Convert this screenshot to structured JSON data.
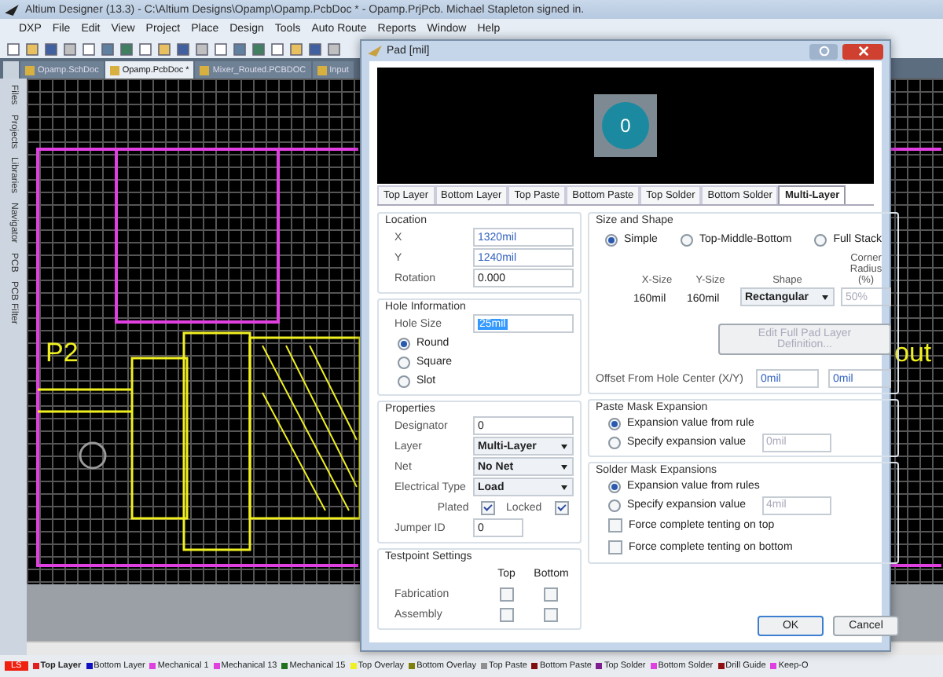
{
  "window": {
    "title": "Altium Designer (13.3) - C:\\Altium Designs\\Opamp\\Opamp.PcbDoc * - Opamp.PrjPcb. Michael Stapleton signed in."
  },
  "menu": [
    "DXP",
    "File",
    "Edit",
    "View",
    "Project",
    "Place",
    "Design",
    "Tools",
    "Auto Route",
    "Reports",
    "Window",
    "Help"
  ],
  "doc_tabs": [
    {
      "label": "Opamp.SchDoc",
      "selected": false
    },
    {
      "label": "Opamp.PcbDoc *",
      "selected": true
    },
    {
      "label": "Mixer_Routed.PCBDOC",
      "selected": false
    },
    {
      "label": "Input",
      "selected": false
    }
  ],
  "side_panels": [
    "Files",
    "Projects",
    "Libraries",
    "Navigator",
    "PCB",
    "PCB Filter"
  ],
  "canvas": {
    "left_label": "P2",
    "right_label": "out"
  },
  "dialog": {
    "title": "Pad [mil]",
    "pad_preview": {
      "designator": "0"
    },
    "tabs": [
      {
        "label": "Top Layer",
        "selected": false
      },
      {
        "label": "Bottom Layer",
        "selected": false
      },
      {
        "label": "Top Paste",
        "selected": false
      },
      {
        "label": "Bottom Paste",
        "selected": false
      },
      {
        "label": "Top Solder",
        "selected": false
      },
      {
        "label": "Bottom Solder",
        "selected": false
      },
      {
        "label": "Multi-Layer",
        "selected": true
      }
    ],
    "location": {
      "title": "Location",
      "fields": [
        {
          "label": "X",
          "value": "1320mil"
        },
        {
          "label": "Y",
          "value": "1240mil"
        },
        {
          "label": "Rotation",
          "value": "0.000"
        }
      ]
    },
    "hole": {
      "title": "Hole Information",
      "label": "Hole Size",
      "value": "25mil",
      "value_selected": true,
      "shapes": [
        {
          "label": "Round",
          "selected": true
        },
        {
          "label": "Square",
          "selected": false
        },
        {
          "label": "Slot",
          "selected": false
        }
      ]
    },
    "properties": {
      "title": "Properties",
      "rows": [
        {
          "kind": "text",
          "label": "Designator",
          "value": "0"
        },
        {
          "kind": "select",
          "label": "Layer",
          "value": "Multi-Layer"
        },
        {
          "kind": "select",
          "label": "Net",
          "value": "No Net"
        },
        {
          "kind": "select",
          "label": "Electrical Type",
          "value": "Load"
        }
      ],
      "checks": [
        {
          "label": "Plated",
          "checked": true
        },
        {
          "label": "Locked",
          "checked": true
        }
      ],
      "jumper": {
        "label": "Jumper ID",
        "value": "0"
      }
    },
    "testpoint": {
      "title": "Testpoint Settings",
      "columns": [
        "Top",
        "Bottom"
      ],
      "rows": [
        {
          "label": "Fabrication",
          "top": false,
          "bottom": false
        },
        {
          "label": "Assembly",
          "top": false,
          "bottom": false
        }
      ]
    },
    "size_shape": {
      "title": "Size and Shape",
      "modes": [
        {
          "label": "Simple",
          "selected": true
        },
        {
          "label": "Top-Middle-Bottom",
          "selected": false
        },
        {
          "label": "Full Stack",
          "selected": false
        }
      ],
      "columns": [
        "X-Size",
        "Y-Size",
        "Shape",
        "Corner Radius (%)"
      ],
      "x_size": "160mil",
      "y_size": "160mil",
      "shape": "Rectangular",
      "corner_radius": {
        "value": "50%",
        "disabled": true
      },
      "edit_button": {
        "label": "Edit Full Pad Layer Definition...",
        "disabled": true
      },
      "offset": {
        "label": "Offset From Hole Center (X/Y)",
        "x": "0mil",
        "y": "0mil"
      }
    },
    "paste_mask": {
      "title": "Paste Mask Expansion",
      "options": [
        {
          "label": "Expansion value from rule",
          "selected": true
        },
        {
          "label": "Specify expansion value",
          "selected": false,
          "value": "0mil"
        }
      ]
    },
    "solder_mask": {
      "title": "Solder Mask Expansions",
      "options": [
        {
          "label": "Expansion value from rules",
          "selected": true
        },
        {
          "label": "Specify expansion value",
          "selected": false,
          "value": "4mil"
        }
      ],
      "checks": [
        {
          "label": "Force complete tenting on top",
          "checked": false
        },
        {
          "label": "Force complete tenting on bottom",
          "checked": false
        }
      ]
    },
    "buttons": [
      {
        "label": "OK",
        "default": true
      },
      {
        "label": "Cancel",
        "default": false
      }
    ]
  },
  "layer_bar": {
    "ls": "LS",
    "layers": [
      {
        "label": "Top Layer",
        "color": "#e02020",
        "selected": true
      },
      {
        "label": "Bottom Layer",
        "color": "#1010c0",
        "selected": false
      },
      {
        "label": "Mechanical 1",
        "color": "#e040e0",
        "selected": false
      },
      {
        "label": "Mechanical 13",
        "color": "#e040e0",
        "selected": false
      },
      {
        "label": "Mechanical 15",
        "color": "#207020",
        "selected": false
      },
      {
        "label": "Top Overlay",
        "color": "#f0f020",
        "selected": false
      },
      {
        "label": "Bottom Overlay",
        "color": "#808010",
        "selected": false
      },
      {
        "label": "Top Paste",
        "color": "#909090",
        "selected": false
      },
      {
        "label": "Bottom Paste",
        "color": "#801010",
        "selected": false
      },
      {
        "label": "Top Solder",
        "color": "#802090",
        "selected": false
      },
      {
        "label": "Bottom Solder",
        "color": "#e040e0",
        "selected": false
      },
      {
        "label": "Drill Guide",
        "color": "#901010",
        "selected": false
      },
      {
        "label": "Keep-O",
        "color": "#e040e0",
        "selected": false
      }
    ]
  }
}
